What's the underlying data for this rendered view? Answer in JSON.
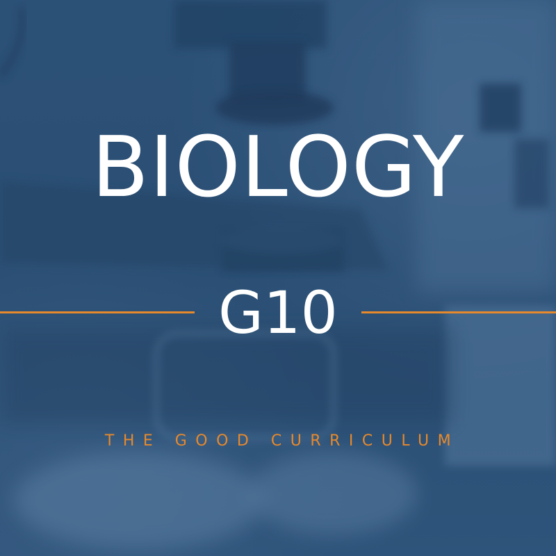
{
  "cover": {
    "title": "BIOLOGY",
    "grade": "G10",
    "tagline": "THE GOOD CURRICULUM"
  },
  "colors": {
    "background": "#30557b",
    "accent": "#e8892b",
    "text": "#ffffff"
  },
  "icons": {
    "background_image": "microscope-photo"
  }
}
